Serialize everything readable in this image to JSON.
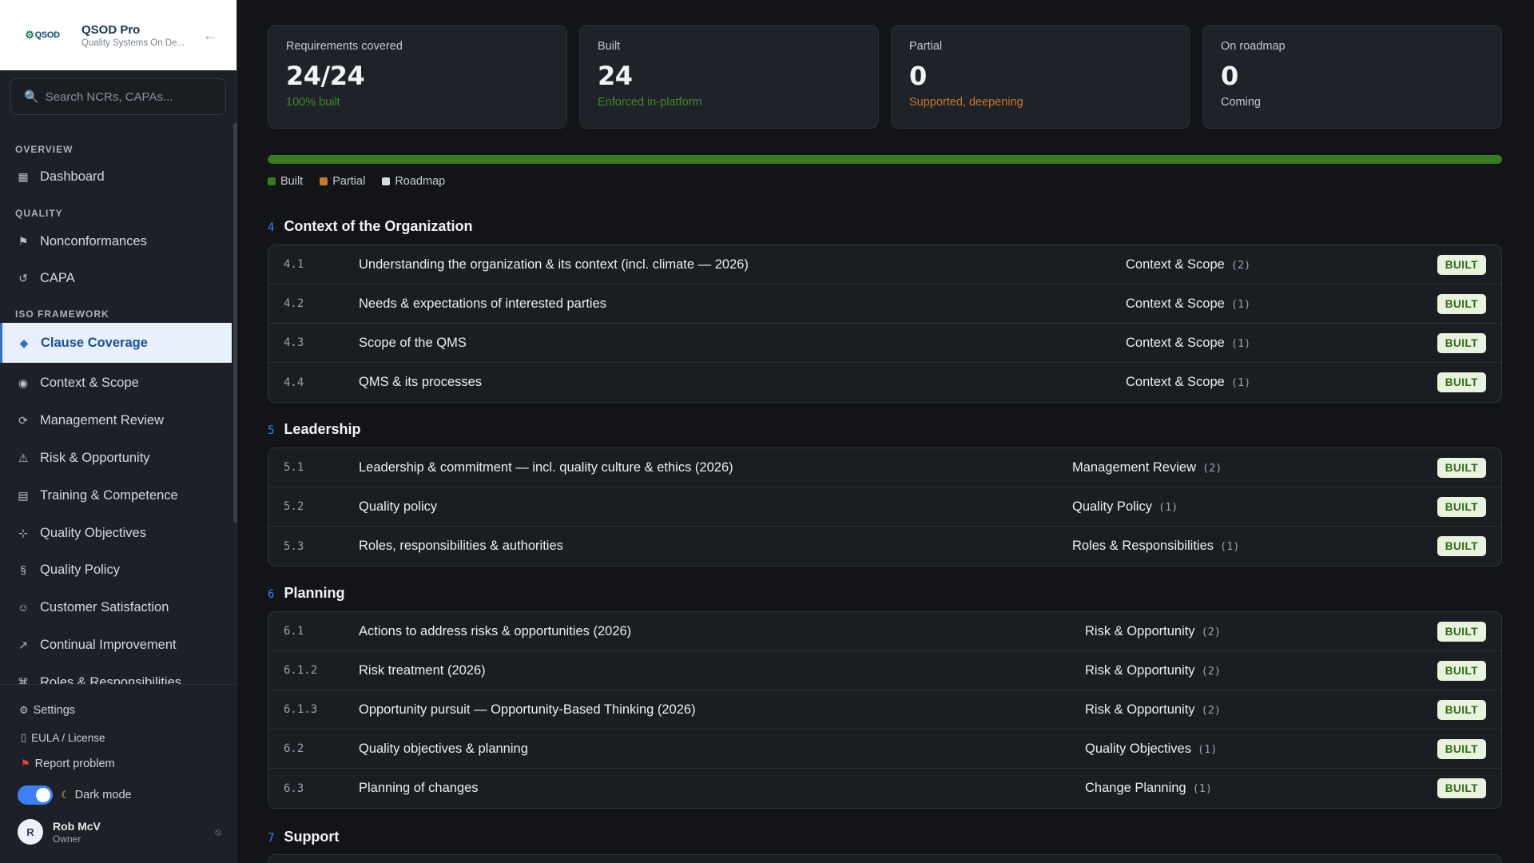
{
  "brand": {
    "logo_text": "QSOD",
    "name": "QSOD Pro",
    "subtitle": "Quality Systems On De..."
  },
  "search": {
    "placeholder": "Search NCRs, CAPAs..."
  },
  "nav": {
    "sections": {
      "overview": "OVERVIEW",
      "quality": "QUALITY",
      "iso": "ISO FRAMEWORK"
    },
    "items": {
      "dashboard": "Dashboard",
      "nonconformances": "Nonconformances",
      "capa": "CAPA",
      "clause_coverage": "Clause Coverage",
      "context_scope": "Context & Scope",
      "management_review": "Management Review",
      "risk_opportunity": "Risk & Opportunity",
      "training": "Training & Competence",
      "quality_objectives": "Quality Objectives",
      "quality_policy": "Quality Policy",
      "customer_satisfaction": "Customer Satisfaction",
      "continual_improvement": "Continual Improvement",
      "roles": "Roles & Responsibilities"
    }
  },
  "footer": {
    "settings": "Settings",
    "eula": "EULA / License",
    "report": "Report problem",
    "dark_mode": "Dark mode",
    "dark_mode_on": true,
    "user_initial": "R",
    "user_name": "Rob McV",
    "user_role": "Owner"
  },
  "stats": [
    {
      "label": "Requirements covered",
      "value": "24/24",
      "sub": "100% built"
    },
    {
      "label": "Built",
      "value": "24",
      "sub": "Enforced in-platform"
    },
    {
      "label": "Partial",
      "value": "0",
      "sub": "Supported, deepening"
    },
    {
      "label": "On roadmap",
      "value": "0",
      "sub": "Coming"
    }
  ],
  "progress": {
    "built_fraction": 1.0
  },
  "legend": {
    "built": "Built",
    "partial": "Partial",
    "roadmap": "Roadmap"
  },
  "colors": {
    "built": "#3a7a1f",
    "partial": "#c9772d",
    "roadmap": "#d8dbe0",
    "accent": "#3c82f6"
  },
  "groups": {
    "g4": {
      "num": "4",
      "name": "Context of the Organization",
      "rows": [
        {
          "num": "4.1",
          "title": "Understanding the organization & its context (incl. climate — 2026)",
          "module": "Context & Scope",
          "count": "(2)",
          "status": "BUILT"
        },
        {
          "num": "4.2",
          "title": "Needs & expectations of interested parties",
          "module": "Context & Scope",
          "count": "(1)",
          "status": "BUILT"
        },
        {
          "num": "4.3",
          "title": "Scope of the QMS",
          "module": "Context & Scope",
          "count": "(1)",
          "status": "BUILT"
        },
        {
          "num": "4.4",
          "title": "QMS & its processes",
          "module": "Context & Scope",
          "count": "(1)",
          "status": "BUILT"
        }
      ]
    },
    "g5": {
      "num": "5",
      "name": "Leadership",
      "rows": [
        {
          "num": "5.1",
          "title": "Leadership & commitment — incl. quality culture & ethics (2026)",
          "module": "Management Review",
          "count": "(2)",
          "status": "BUILT"
        },
        {
          "num": "5.2",
          "title": "Quality policy",
          "module": "Quality Policy",
          "count": "(1)",
          "status": "BUILT"
        },
        {
          "num": "5.3",
          "title": "Roles, responsibilities & authorities",
          "module": "Roles & Responsibilities",
          "count": "(1)",
          "status": "BUILT"
        }
      ]
    },
    "g6": {
      "num": "6",
      "name": "Planning",
      "rows": [
        {
          "num": "6.1",
          "title": "Actions to address risks & opportunities (2026)",
          "module": "Risk & Opportunity",
          "count": "(2)",
          "status": "BUILT"
        },
        {
          "num": "6.1.2",
          "title": "Risk treatment (2026)",
          "module": "Risk & Opportunity",
          "count": "(2)",
          "status": "BUILT"
        },
        {
          "num": "6.1.3",
          "title": "Opportunity pursuit — Opportunity-Based Thinking (2026)",
          "module": "Risk & Opportunity",
          "count": "(2)",
          "status": "BUILT"
        },
        {
          "num": "6.2",
          "title": "Quality objectives & planning",
          "module": "Quality Objectives",
          "count": "(1)",
          "status": "BUILT"
        },
        {
          "num": "6.3",
          "title": "Planning of changes",
          "module": "Change Planning",
          "count": "(1)",
          "status": "BUILT"
        }
      ]
    },
    "g7": {
      "num": "7",
      "name": "Support"
    }
  }
}
